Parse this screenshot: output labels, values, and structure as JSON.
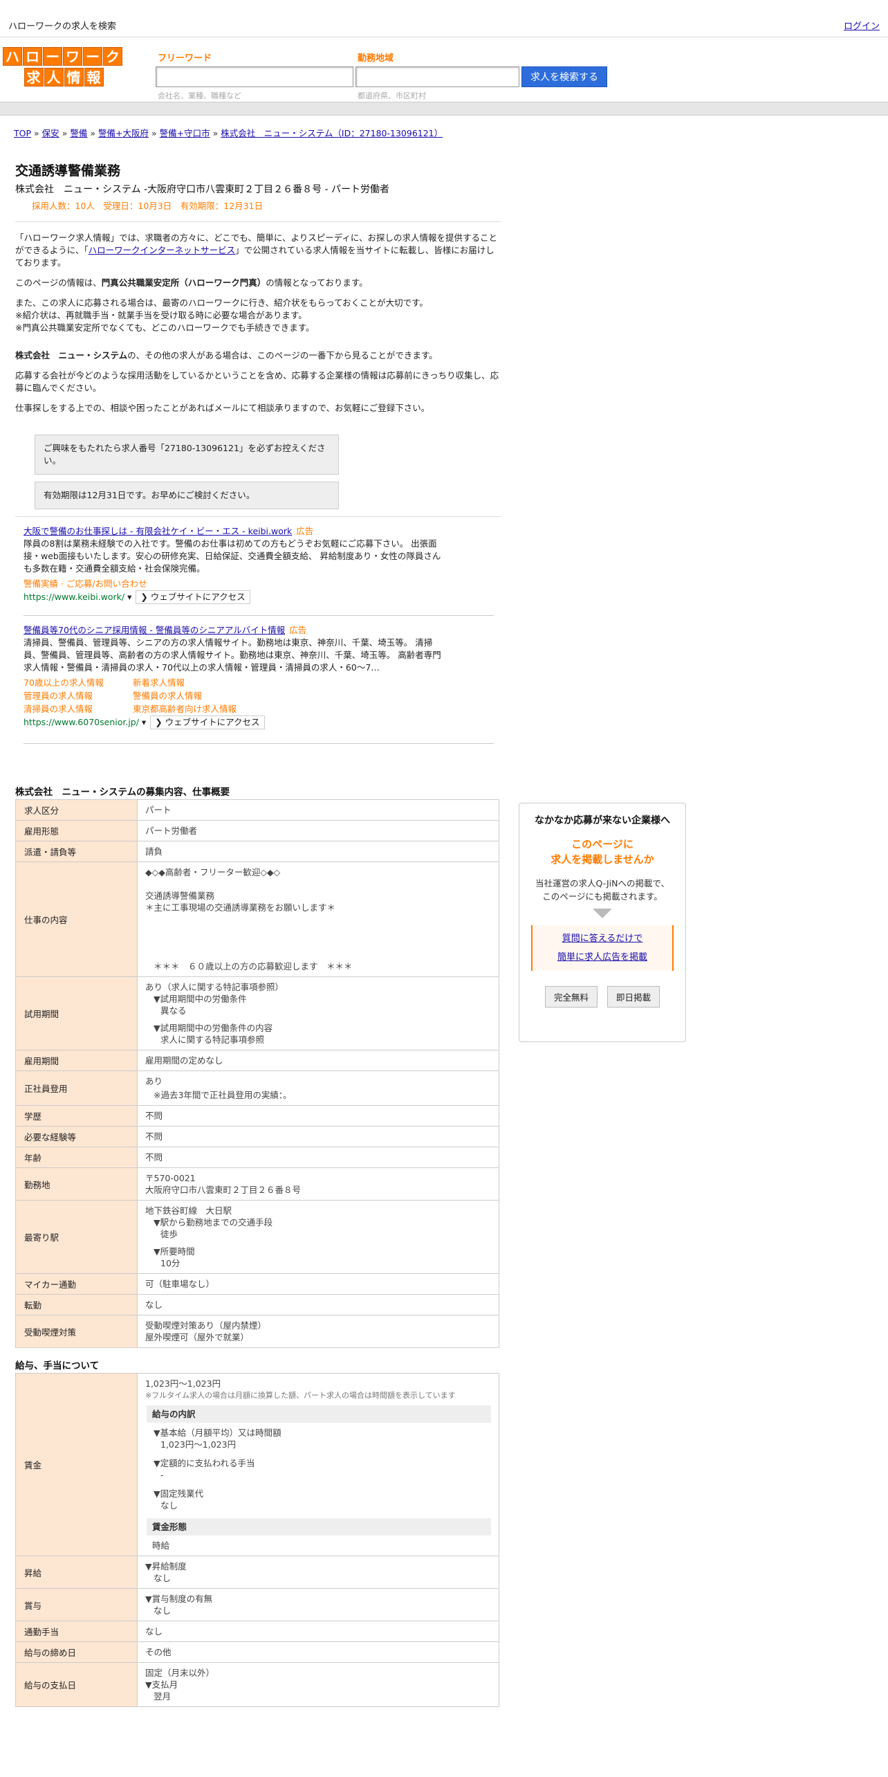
{
  "topbar": {
    "site_title": "ハローワークの求人を検索",
    "login": "ログイン"
  },
  "logo": {
    "row1": [
      "ハ",
      "ロ",
      "ー",
      "ワ",
      "ー",
      "ク"
    ],
    "row2": [
      "求",
      "人",
      "情",
      "報"
    ]
  },
  "search": {
    "keyword_label": "フリーワード",
    "keyword_placeholder": "",
    "keyword_hint": "会社名、業種、職種など",
    "area_label": "勤務地域",
    "area_placeholder": "",
    "area_hint": "都道府県、市区町村",
    "button": "求人を検索する"
  },
  "breadcrumb": [
    {
      "label": "TOP"
    },
    {
      "label": "保安"
    },
    {
      "label": "警備"
    },
    {
      "label": "警備+大阪府"
    },
    {
      "label": "警備+守口市"
    },
    {
      "label": "株式会社　ニュー・システム（ID：27180-13096121）"
    }
  ],
  "breadcrumb_sep": "»",
  "job": {
    "title": "交通誘導警備業務",
    "company_line": "株式会社　ニュー・システム -大阪府守口市八雲東町２丁目２６番８号 - パート労働者",
    "meta": "採用人数：10人　受理日：10月3日　有効期限：12月31日"
  },
  "intro": {
    "p1a": "「ハローワーク求人情報」では、求職者の方々に、どこでも、簡単に、よりスピーディに、お探しの求人情報を提供することができるように、「",
    "p1_link": "ハローワークインターネットサービス",
    "p1b": "」で公開されている求人情報を当サイトに転載し、皆様にお届けしております。",
    "p2a": "このページの情報は、",
    "p2_bold": "門真公共職業安定所（ハローワーク門真）",
    "p2b": "の情報となっております。",
    "p3": "また、この求人に応募される場合は、最寄のハローワークに行き、紹介状をもらっておくことが大切です。",
    "p3b": "※紹介状は、再就職手当・就業手当を受け取る時に必要な場合があります。",
    "p3c": "※門真公共職業安定所でなくても、どこのハローワークでも手続きできます。",
    "p4_bold": "株式会社　ニュー・システム",
    "p4": "の、その他の求人がある場合は、このページの一番下から見ることができます。",
    "p5": "応募する会社が今どのような採用活動をしているかということを含め、応募する企業様の情報は応募前にきっちり収集し、応募に臨んでください。",
    "p6": "仕事探しをする上での、相談や困ったことがあればメールにて相談承りますので、お気軽にご登録下さい。"
  },
  "notices": {
    "n1": "ご興味をもたれたら求人番号「27180-13096121」を必ずお控えください。",
    "n2": "有効期限は12月31日です。お早めにご検討ください。"
  },
  "ads": [
    {
      "title": "大阪で警備のお仕事探しは - 有限会社ケイ・ビー・エス - keibi.work",
      "label": "広告",
      "desc": "隊員の8割は業務未経験での入社です。警備のお仕事は初めての方もどうぞお気軽にご応募下さい。 出張面接・web面接もいたします。安心の研修充実、日給保証、交通費全額支給、 昇給制度あり・女性の隊員さんも多数在籍・交通費全額支給・社会保険完備。",
      "sublinks": [
        "警備実績 · ご応募/お問い合わせ"
      ],
      "url": "https://www.keibi.work/",
      "visit": "❯ ウェブサイトにアクセス"
    },
    {
      "title": "警備員等70代のシニア採用情報 - 警備員等のシニアアルバイト情報",
      "label": "広告",
      "desc": "清掃員、警備員、管理員等、シニアの方の求人情報サイト。勤務地は東京、神奈川、千葉、埼玉等。 清掃員、警備員、管理員等、高齢者の方の求人情報サイト。勤務地は東京、神奈川、千葉、埼玉等。 高齢者専門求人情報・警備員・清掃員の求人・70代以上の求人情報・管理員・清掃員の求人・60～7…",
      "sublinks": [
        "70歳以上の求人情報",
        "新着求人情報",
        "管理員の求人情報",
        "警備員の求人情報",
        "清掃員の求人情報",
        "東京都高齢者向け求人情報"
      ],
      "url": "https://www.6070senior.jp/",
      "visit": "❯ ウェブサイトにアクセス"
    }
  ],
  "recruit": {
    "section_title": "株式会社　ニュー・システムの募集内容、仕事概要",
    "rows": [
      {
        "th": "求人区分",
        "td": "パート"
      },
      {
        "th": "雇用形態",
        "td": "パート労働者"
      },
      {
        "th": "派遣・請負等",
        "td": "請負"
      }
    ],
    "work_th": "仕事の内容",
    "work_l1": "◆◇◆高齢者・フリーター歓迎◇◆◇",
    "work_l2": "交通誘導警備業務",
    "work_l3": "＊主に工事現場の交通誘導業務をお願いします＊",
    "work_l4": "＊＊＊　６０歳以上の方の応募歓迎します　＊＊＊",
    "trial_th": "試用期間",
    "trial_l1": "あり（求人に関する特記事項参照）",
    "trial_l2": "▼試用期間中の労働条件",
    "trial_l3": "異なる",
    "trial_l4": "▼試用期間中の労働条件の内容",
    "trial_l5": "求人に関する特記事項参照",
    "period_th": "雇用期間",
    "period_td": "雇用期間の定めなし",
    "regular_th": "正社員登用",
    "regular_l1": "あり",
    "regular_l2": "※過去3年間で正社員登用の実績：。",
    "edu_th": "学歴",
    "edu_td": "不問",
    "exp_th": "必要な経験等",
    "exp_td": "不問",
    "age_th": "年齢",
    "age_td": "不問",
    "place_th": "勤務地",
    "place_l1": "〒570-0021",
    "place_l2": "大阪府守口市八雲東町２丁目２６番８号",
    "station_th": "最寄り駅",
    "station_l1": "地下鉄谷町線　大日駅",
    "station_l2": "▼駅から勤務地までの交通手段",
    "station_l3": "徒歩",
    "station_l4": "▼所要時間",
    "station_l5": "10分",
    "car_th": "マイカー通勤",
    "car_td": "可（駐車場なし）",
    "transfer_th": "転勤",
    "transfer_td": "なし",
    "smoke_th": "受動喫煙対策",
    "smoke_l1": "受動喫煙対策あり（屋内禁煙）",
    "smoke_l2": "屋外喫煙可（屋外で就業）"
  },
  "salary": {
    "section_title": "給与、手当について",
    "wage_th": "賃金",
    "wage_l1": "1,023円〜1,023円",
    "wage_note": "※フルタイム求人の場合は月額に換算した額、パート求人の場合は時間額を表示しています",
    "breakdown_title": "給与の内訳",
    "b1": "▼基本給（月額平均）又は時間額",
    "b1v": "1,023円〜1,023円",
    "b2": "▼定額的に支払われる手当",
    "b2v": "-",
    "b3": "▼固定残業代",
    "b3v": "なし",
    "form_title": "賃金形態",
    "form_v": "時給",
    "raise_th": "昇給",
    "raise_l1": "▼昇給制度",
    "raise_l2": "なし",
    "bonus_th": "賞与",
    "bonus_l1": "▼賞与制度の有無",
    "bonus_l2": "なし",
    "commute_th": "通勤手当",
    "commute_td": "なし",
    "close_th": "給与の締め日",
    "close_td": "その他",
    "pay_th": "給与の支払日",
    "pay_l1": "固定（月末以外）",
    "pay_l2": "▼支払月",
    "pay_l3": "翌月"
  },
  "sidebar": {
    "title": "なかなか応募が来ない企業様へ",
    "em1": "このページに",
    "em2": "求人を掲載しませんか",
    "body1": "当社運営の求人Q-JiNへの掲載で、",
    "body2": "このページにも掲載されます。",
    "link1": "質問に答えるだけで",
    "link2": "簡単に求人広告を掲載",
    "btn1": "完全無料",
    "btn2": "即日掲載"
  }
}
